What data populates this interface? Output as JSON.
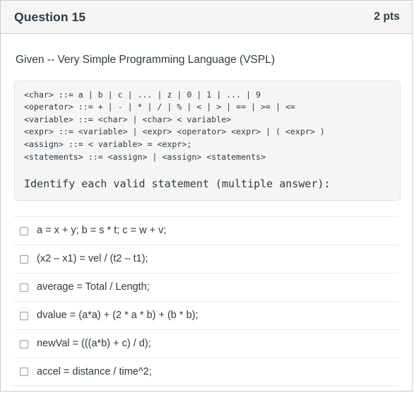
{
  "header": {
    "title": "Question 15",
    "points": "2 pts"
  },
  "body": {
    "prompt": "Given -- Very Simple Programming Language (VSPL)",
    "code_lines": [
      "<char> ::= a | b | c | ... | z | 0 | 1 | ... | 9",
      "<operator> ::= + | - | * | / | % | < | > | == | >= | <=",
      "<variable> ::= <char> | <char> < variable>",
      "<expr> ::= <variable> | <expr> <operator> <expr> | ( <expr> )",
      "<assign> ::= < variable> = <expr>;",
      "<statements> ::= <assign> | <assign> <statements>"
    ],
    "code_instruction": "Identify each valid statement (multiple answer):"
  },
  "answers": [
    {
      "label": "a = x + y; b = s * t; c = w + v;",
      "checked": false
    },
    {
      "label": "(x2 – x1) = vel / (t2 – t1);",
      "checked": false
    },
    {
      "label": "average = Total / Length;",
      "checked": false
    },
    {
      "label": "dvalue = (a*a) + (2 * a * b) + (b * b);",
      "checked": false
    },
    {
      "label": "newVal = (((a*b) + c) / d);",
      "checked": false
    },
    {
      "label": "accel = distance / time^2;",
      "checked": false
    }
  ],
  "colors": {
    "text": "#2d3b45",
    "header_bg": "#f5f5f5",
    "card_border": "#c7cdd1",
    "code_bg": "#f5f5f5",
    "code_border": "#dfe3e6",
    "row_divider": "#e8eaec",
    "checkbox_border": "#919ca3"
  }
}
